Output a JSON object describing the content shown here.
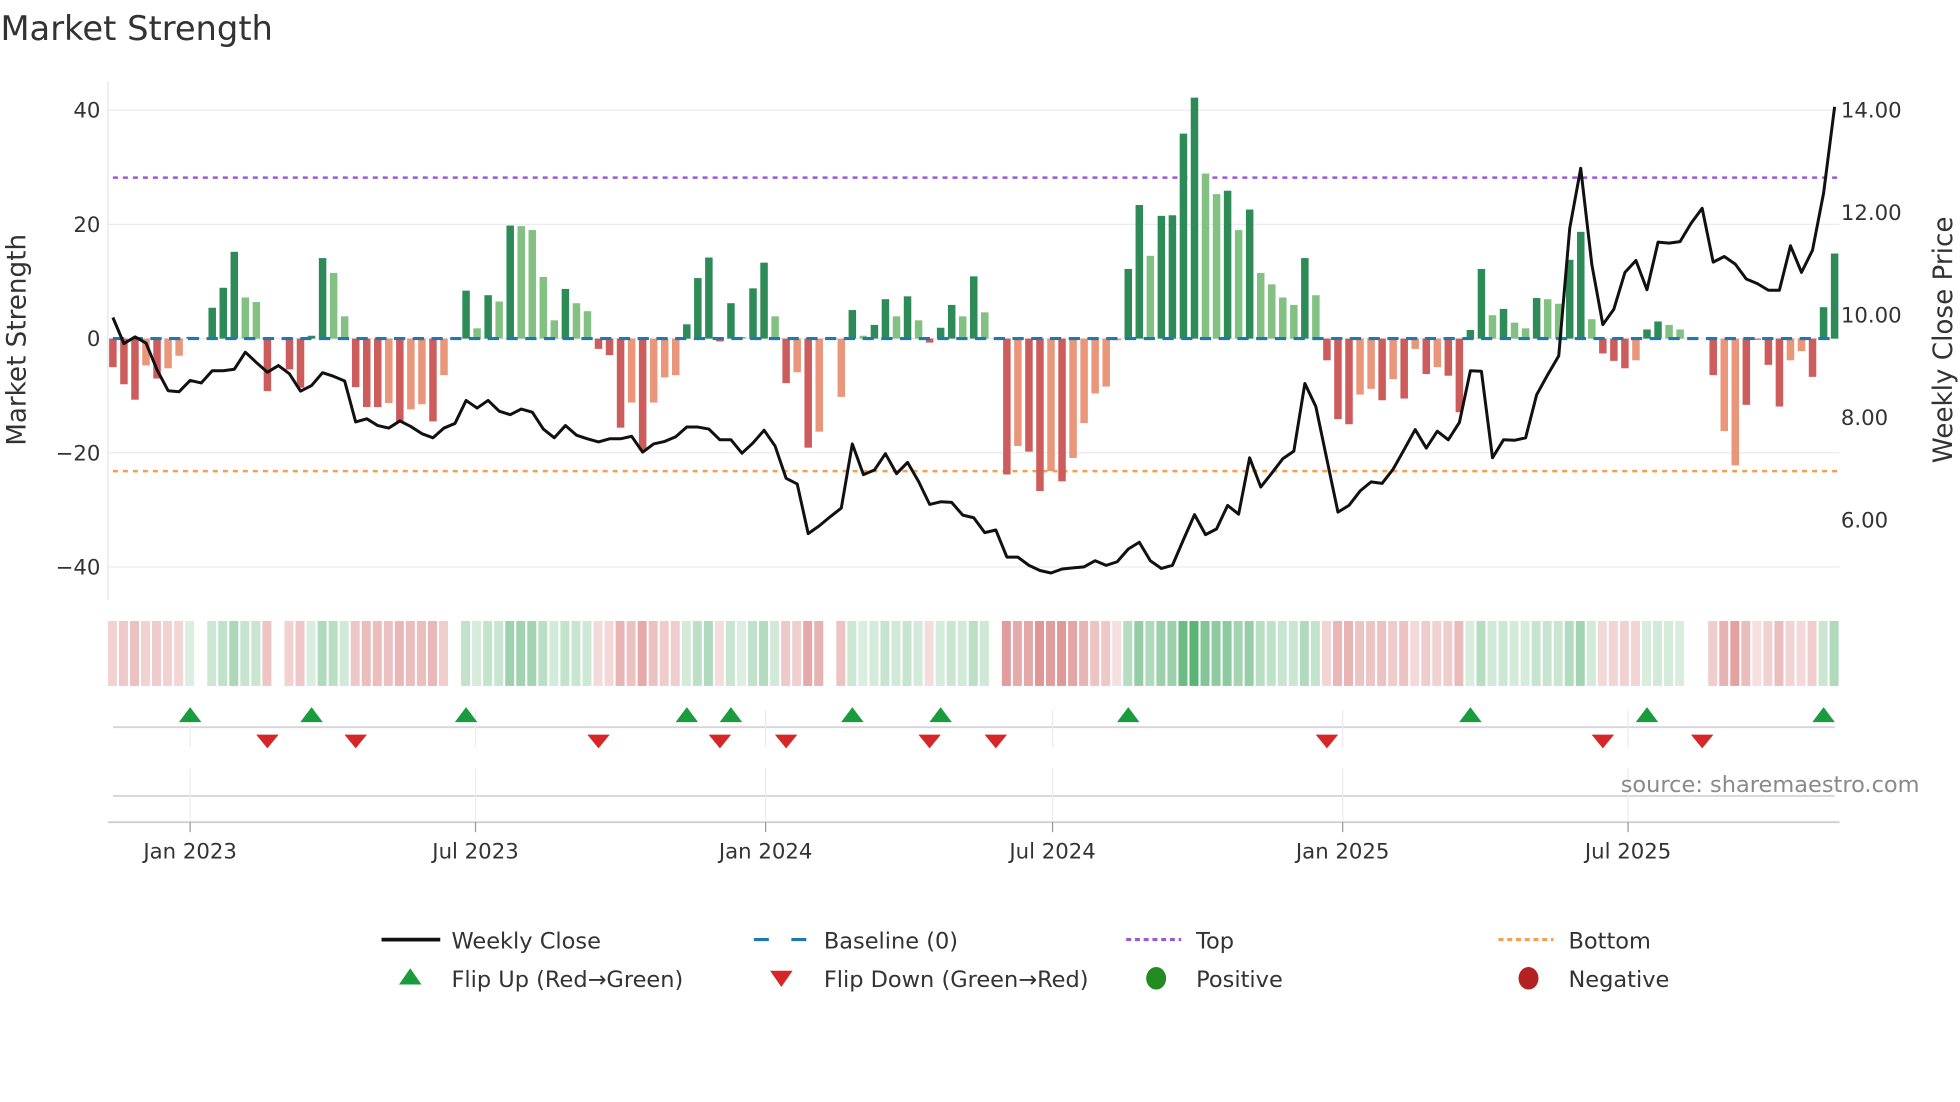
{
  "chart_data": {
    "type": "bar",
    "title": "Market Strength",
    "ylabel": "Market Strength",
    "y2label": "Weekly Close Price",
    "ylim": [
      -44,
      46
    ],
    "y2lim": [
      4.4,
      14.4
    ],
    "yticks": [
      {
        "v": 40,
        "label": "40"
      },
      {
        "v": 20,
        "label": "20"
      },
      {
        "v": 0,
        "label": "0"
      },
      {
        "v": -20,
        "label": "−20"
      },
      {
        "v": -40,
        "label": "−40"
      }
    ],
    "y2ticks": [
      {
        "v": 14,
        "label": "14.00"
      },
      {
        "v": 12,
        "label": "12.00"
      },
      {
        "v": 10,
        "label": "10.00"
      },
      {
        "v": 8,
        "label": "8.00"
      },
      {
        "v": 6,
        "label": "6.00"
      }
    ],
    "start_week": "2022-11-13",
    "xticks": [
      {
        "date": "2023-01-01",
        "label": "Jan 2023"
      },
      {
        "date": "2023-07-01",
        "label": "Jul 2023"
      },
      {
        "date": "2024-01-01",
        "label": "Jan 2024"
      },
      {
        "date": "2024-07-01",
        "label": "Jul 2024"
      },
      {
        "date": "2025-01-01",
        "label": "Jan 2025"
      },
      {
        "date": "2025-07-01",
        "label": "Jul 2025"
      }
    ],
    "top": 28.2,
    "bottom": -23.2,
    "baseline": 0,
    "strength": [
      -5,
      -8,
      -10.7,
      -4.7,
      -7,
      -5.2,
      -3,
      0.3,
      0,
      5.4,
      8.9,
      15.2,
      7.2,
      6.4,
      -9.2,
      0,
      -5.4,
      -8.6,
      0.5,
      14.1,
      11.5,
      3.9,
      -8.5,
      -12,
      -12,
      -11.3,
      -14.5,
      -12.4,
      -11.5,
      -14.5,
      -6.4,
      0,
      8.4,
      1.8,
      7.6,
      6.5,
      19.8,
      19.7,
      19,
      10.8,
      3.2,
      8.7,
      6.2,
      4.8,
      -1.8,
      -2.9,
      -15.6,
      -11.2,
      -19.5,
      -11.2,
      -6.8,
      -6.4,
      2.5,
      10.6,
      14.2,
      -0.5,
      6.2,
      0.3,
      8.8,
      13.3,
      3.9,
      -7.8,
      -5.9,
      -19.1,
      -16.3,
      0,
      -10.2,
      5,
      0.5,
      2.4,
      6.9,
      3.9,
      7.4,
      3.2,
      -0.7,
      1.9,
      5.9,
      3.9,
      10.9,
      4.6,
      0,
      -23.8,
      -18.8,
      -19.8,
      -26.7,
      -23.2,
      -25,
      -20.9,
      -14.8,
      -9.6,
      -8.4,
      -0.3,
      12.2,
      23.4,
      14.5,
      21.5,
      21.6,
      35.9,
      42.2,
      28.9,
      25.3,
      25.9,
      19,
      22.6,
      11.5,
      9.5,
      7.2,
      5.9,
      14.1,
      7.6,
      -3.8,
      -14.1,
      -15,
      -9.8,
      -8.8,
      -10.8,
      -7.1,
      -10.5,
      -1.8,
      -6.2,
      -5,
      -6.5,
      -12.9,
      1.5,
      12.2,
      4.1,
      5.2,
      2.8,
      1.8,
      7.1,
      6.9,
      6.1,
      13.8,
      18.7,
      3.4,
      -2.6,
      -3.9,
      -5.2,
      -3.8,
      1.6,
      3,
      2.4,
      1.6,
      0,
      0,
      -6.4,
      -16.2,
      -22.2,
      -11.6,
      -0.2,
      -4.6,
      -11.9,
      -3.8,
      -2.2,
      -6.7,
      5.5,
      14.9
    ],
    "tones": "dddldlld-dddlld-ddddlldddldlldl-dldldlllldlldddldllldddddlddldldl-ldlddldldddldl-dlddldlllllddlddddlldldlllldldddlldldldlddddldlldllddldddlddll--dllddddllddd",
    "close": [
      9.95,
      9.44,
      9.57,
      9.45,
      8.93,
      8.52,
      8.5,
      8.72,
      8.67,
      8.91,
      8.91,
      8.94,
      9.27,
      9.07,
      8.88,
      9.01,
      8.85,
      8.51,
      8.62,
      8.87,
      8.8,
      8.71,
      7.91,
      7.97,
      7.84,
      7.79,
      7.93,
      7.82,
      7.68,
      7.6,
      7.79,
      7.88,
      8.33,
      8.18,
      8.33,
      8.12,
      8.05,
      8.16,
      8.1,
      7.77,
      7.6,
      7.84,
      7.65,
      7.58,
      7.52,
      7.58,
      7.58,
      7.63,
      7.32,
      7.48,
      7.53,
      7.62,
      7.81,
      7.81,
      7.77,
      7.56,
      7.56,
      7.3,
      7.5,
      7.75,
      7.44,
      6.81,
      6.7,
      5.73,
      5.88,
      6.06,
      6.23,
      7.48,
      6.88,
      6.97,
      7.29,
      6.9,
      7.12,
      6.75,
      6.3,
      6.35,
      6.34,
      6.09,
      6.04,
      5.75,
      5.8,
      5.27,
      5.27,
      5.11,
      5.01,
      4.96,
      5.04,
      5.06,
      5.08,
      5.2,
      5.11,
      5.18,
      5.43,
      5.56,
      5.2,
      5.05,
      5.11,
      5.61,
      6.1,
      5.71,
      5.82,
      6.28,
      6.11,
      7.21,
      6.64,
      6.91,
      7.19,
      7.34,
      8.66,
      8.21,
      7.17,
      6.15,
      6.28,
      6.56,
      6.74,
      6.71,
      6.99,
      7.37,
      7.76,
      7.4,
      7.73,
      7.56,
      7.9,
      8.91,
      8.9,
      7.21,
      7.56,
      7.55,
      7.6,
      8.44,
      8.83,
      9.2,
      11.69,
      12.86,
      10.98,
      9.81,
      10.11,
      10.83,
      11.06,
      10.49,
      11.42,
      11.4,
      11.43,
      11.79,
      12.08,
      11.03,
      11.14,
      10.99,
      10.7,
      10.61,
      10.48,
      10.48,
      11.35,
      10.83,
      11.26,
      12.38,
      14.06
    ],
    "flip_up_weeks": [
      7,
      18,
      32,
      52,
      56,
      67,
      75,
      92,
      123,
      139,
      155
    ],
    "flip_down_weeks": [
      14,
      22,
      44,
      55,
      61,
      74,
      80,
      110,
      135,
      144
    ],
    "legend": [
      {
        "key": "close",
        "label": "Weekly Close"
      },
      {
        "key": "baseline",
        "label": "Baseline (0)"
      },
      {
        "key": "top",
        "label": "Top"
      },
      {
        "key": "bottom",
        "label": "Bottom"
      },
      {
        "key": "flip_up",
        "label": "Flip Up (Red→Green)"
      },
      {
        "key": "flip_down",
        "label": "Flip Down (Green→Red)"
      },
      {
        "key": "positive",
        "label": "Positive"
      },
      {
        "key": "negative",
        "label": "Negative"
      }
    ],
    "source": "source: sharemaestro.com",
    "colors": {
      "pos_dark": "#2e8b57",
      "pos_light": "#82c182",
      "neg_dark": "#cd5c5c",
      "neg_light": "#e9967a",
      "close": "#111111",
      "baseline": "#1f77b4",
      "top": "#9b59d6",
      "bottom": "#f0a050",
      "flip_up": "#1a9c3e",
      "flip_down": "#d62728",
      "positive": "#228b22",
      "negative": "#b22222"
    }
  }
}
